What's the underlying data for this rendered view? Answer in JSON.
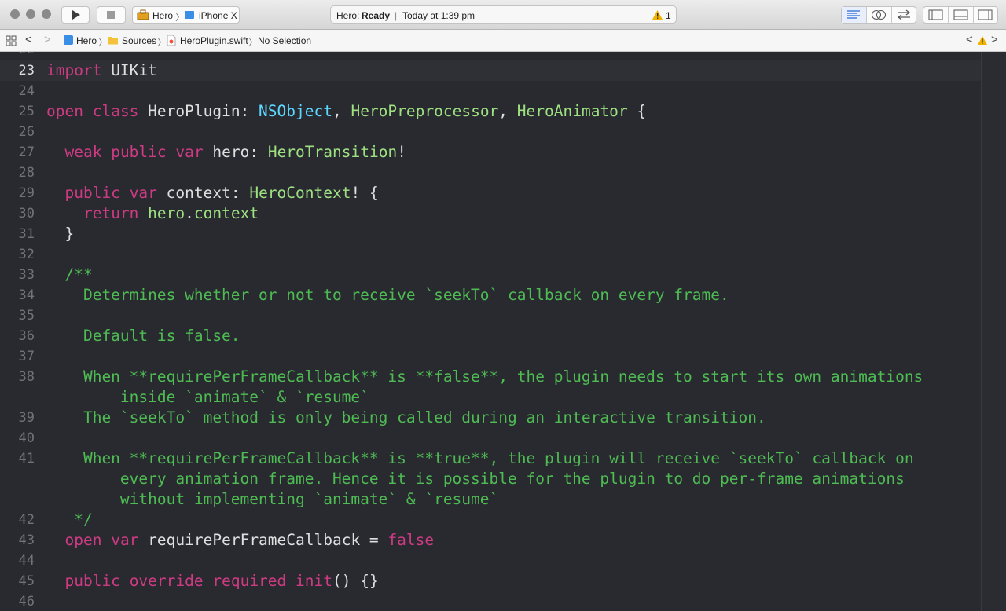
{
  "toolbar": {
    "scheme_target": "Hero",
    "scheme_device": "iPhone X",
    "status_project": "Hero:",
    "status_state": "Ready",
    "status_time": "Today at 1:39 pm",
    "warning_count": "1"
  },
  "jumpbar": {
    "crumbs": [
      "Hero",
      "Sources",
      "HeroPlugin.swift",
      "No Selection"
    ]
  },
  "editor": {
    "partial_top": "22",
    "lines": [
      {
        "n": "23",
        "tokens": [
          [
            "kw",
            "import"
          ],
          [
            "pl",
            " UIKit"
          ]
        ]
      },
      {
        "n": "24",
        "tokens": []
      },
      {
        "n": "25",
        "tokens": [
          [
            "kw",
            "open"
          ],
          [
            "pl",
            " "
          ],
          [
            "kw",
            "class"
          ],
          [
            "pl",
            " HeroPlugin: "
          ],
          [
            "ns",
            "NSObject"
          ],
          [
            "pl",
            ", "
          ],
          [
            "ty",
            "HeroPreprocessor"
          ],
          [
            "pl",
            ", "
          ],
          [
            "ty",
            "HeroAnimator"
          ],
          [
            "pl",
            " {"
          ]
        ]
      },
      {
        "n": "26",
        "tokens": []
      },
      {
        "n": "27",
        "tokens": [
          [
            "pl",
            "  "
          ],
          [
            "kw",
            "weak"
          ],
          [
            "pl",
            " "
          ],
          [
            "kw",
            "public"
          ],
          [
            "pl",
            " "
          ],
          [
            "kw",
            "var"
          ],
          [
            "pl",
            " hero: "
          ],
          [
            "ty",
            "HeroTransition"
          ],
          [
            "pl",
            "!"
          ]
        ]
      },
      {
        "n": "28",
        "tokens": []
      },
      {
        "n": "29",
        "tokens": [
          [
            "pl",
            "  "
          ],
          [
            "kw",
            "public"
          ],
          [
            "pl",
            " "
          ],
          [
            "kw",
            "var"
          ],
          [
            "pl",
            " context: "
          ],
          [
            "ty",
            "HeroContext"
          ],
          [
            "pl",
            "! {"
          ]
        ]
      },
      {
        "n": "30",
        "tokens": [
          [
            "pl",
            "    "
          ],
          [
            "kw",
            "return"
          ],
          [
            "pl",
            " "
          ],
          [
            "ty",
            "hero"
          ],
          [
            "pl",
            "."
          ],
          [
            "ty",
            "context"
          ]
        ]
      },
      {
        "n": "31",
        "tokens": [
          [
            "pl",
            "  }"
          ]
        ]
      },
      {
        "n": "32",
        "tokens": []
      },
      {
        "n": "33",
        "tokens": [
          [
            "cm",
            "  /**"
          ]
        ]
      },
      {
        "n": "34",
        "tokens": [
          [
            "cm",
            "    Determines whether or not to receive `seekTo` callback on every frame."
          ]
        ]
      },
      {
        "n": "35",
        "tokens": []
      },
      {
        "n": "36",
        "tokens": [
          [
            "cm",
            "    Default is false."
          ]
        ]
      },
      {
        "n": "37",
        "tokens": []
      },
      {
        "n": "38",
        "tokens": [
          [
            "cm",
            "    When **requirePerFrameCallback** is **false**, the plugin needs to start its own animations"
          ]
        ]
      },
      {
        "n": "",
        "tokens": [
          [
            "cm",
            "        inside `animate` & `resume`"
          ]
        ]
      },
      {
        "n": "39",
        "tokens": [
          [
            "cm",
            "    The `seekTo` method is only being called during an interactive transition."
          ]
        ]
      },
      {
        "n": "40",
        "tokens": []
      },
      {
        "n": "41",
        "tokens": [
          [
            "cm",
            "    When **requirePerFrameCallback** is **true**, the plugin will receive `seekTo` callback on"
          ]
        ]
      },
      {
        "n": "",
        "tokens": [
          [
            "cm",
            "        every animation frame. Hence it is possible for the plugin to do per-frame animations"
          ]
        ]
      },
      {
        "n": "",
        "tokens": [
          [
            "cm",
            "        without implementing `animate` & `resume`"
          ]
        ]
      },
      {
        "n": "42",
        "tokens": [
          [
            "cm",
            "   */"
          ]
        ]
      },
      {
        "n": "43",
        "tokens": [
          [
            "pl",
            "  "
          ],
          [
            "kw",
            "open"
          ],
          [
            "pl",
            " "
          ],
          [
            "kw",
            "var"
          ],
          [
            "pl",
            " requirePerFrameCallback = "
          ],
          [
            "kw",
            "false"
          ]
        ]
      },
      {
        "n": "44",
        "tokens": []
      },
      {
        "n": "45",
        "tokens": [
          [
            "pl",
            "  "
          ],
          [
            "kw",
            "public"
          ],
          [
            "pl",
            " "
          ],
          [
            "kw",
            "override"
          ],
          [
            "pl",
            " "
          ],
          [
            "kw",
            "required"
          ],
          [
            "pl",
            " "
          ],
          [
            "kw",
            "init"
          ],
          [
            "pl",
            "() {}"
          ]
        ]
      },
      {
        "n": "46",
        "tokens": []
      }
    ]
  },
  "colors": {
    "keyword": "#ce3b83",
    "type": "#9ee181",
    "ns_type": "#5dd8ff",
    "comment": "#4ebb53",
    "plain": "#dfdfe0",
    "background": "#292a30"
  }
}
